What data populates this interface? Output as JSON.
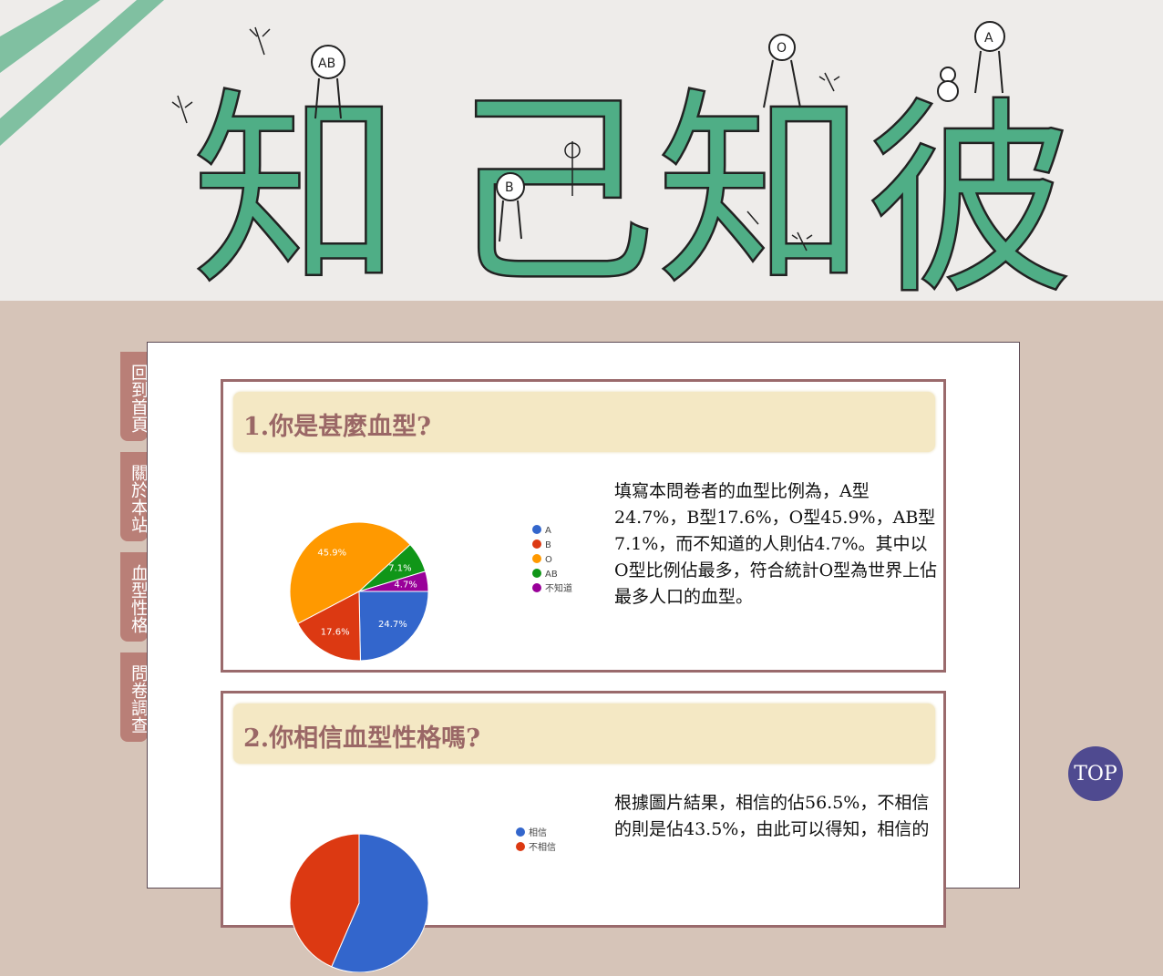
{
  "banner": {
    "chars": [
      "知",
      "己",
      "知",
      "彼"
    ],
    "figure_labels": [
      "AB",
      "B",
      "O",
      "A"
    ]
  },
  "nav": {
    "items": [
      "回到首頁",
      "關於本站",
      "血型性格",
      "問卷調查"
    ]
  },
  "survey": {
    "q1": {
      "title": "1.你是甚麼血型?",
      "description": "填寫本問卷者的血型比例為，A型24.7%，B型17.6%，O型45.9%，AB型7.1%，而不知道的人則佔4.7%。其中以O型比例佔最多，符合統計O型為世界上佔最多人口的血型。"
    },
    "q2": {
      "title": "2.你相信血型性格嗎?",
      "description": "根據圖片結果，相信的佔56.5%，不相信的則是佔43.5%，由此可以得知，相信的"
    }
  },
  "top_button": "TOP",
  "colors": {
    "accent": "#9a6766",
    "nav": "#b97f77",
    "top": "#4f4a90",
    "qbar": "#f4e8c4"
  },
  "chart_data": [
    {
      "type": "pie",
      "categories": [
        "A",
        "B",
        "O",
        "AB",
        "不知道"
      ],
      "values": [
        24.7,
        17.6,
        45.9,
        7.1,
        4.7
      ],
      "labels": [
        "24.7%",
        "17.6%",
        "45.9%",
        "7.1%",
        "4.7%"
      ],
      "colors": [
        "#3366cc",
        "#dc3912",
        "#ff9900",
        "#109618",
        "#990099"
      ],
      "legend": "right"
    },
    {
      "type": "pie",
      "categories": [
        "相信",
        "不相信"
      ],
      "values": [
        56.5,
        43.5
      ],
      "colors": [
        "#3366cc",
        "#dc3912"
      ],
      "legend": "right"
    }
  ]
}
